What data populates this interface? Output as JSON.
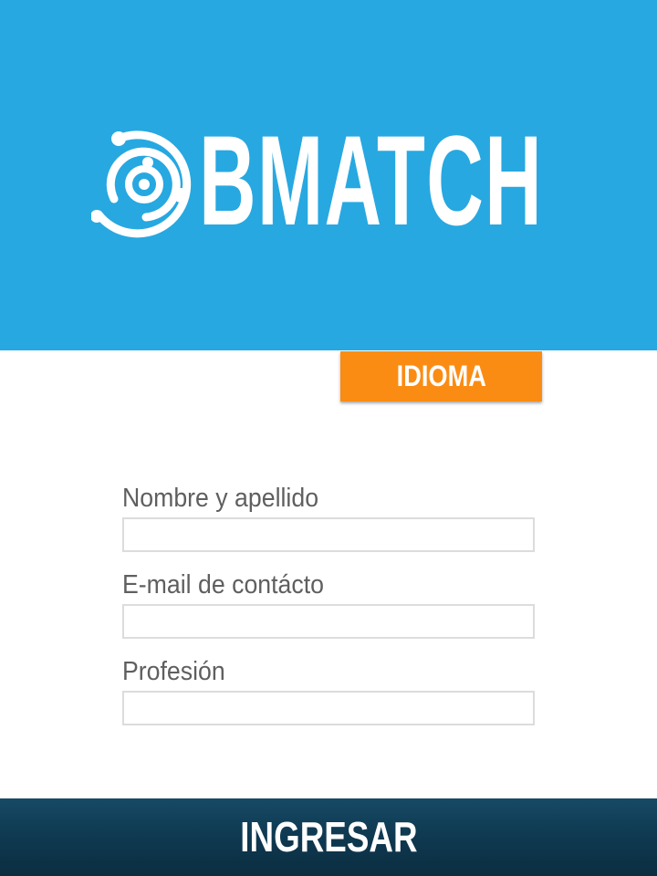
{
  "app": {
    "brand_name": "BMATCH",
    "header_color": "#27a8e1",
    "accent_color": "#fb8c13",
    "footer_color": "#0f3a52"
  },
  "language": {
    "button_label": "IDIOMA"
  },
  "form": {
    "fields": [
      {
        "label": "Nombre y apellido",
        "value": "",
        "placeholder": ""
      },
      {
        "label": "E-mail de contácto",
        "value": "",
        "placeholder": ""
      },
      {
        "label": "Profesión",
        "value": "",
        "placeholder": ""
      }
    ]
  },
  "footer": {
    "submit_label": "INGRESAR"
  },
  "icons": {
    "logo_mark": "orbit-logo-icon"
  }
}
